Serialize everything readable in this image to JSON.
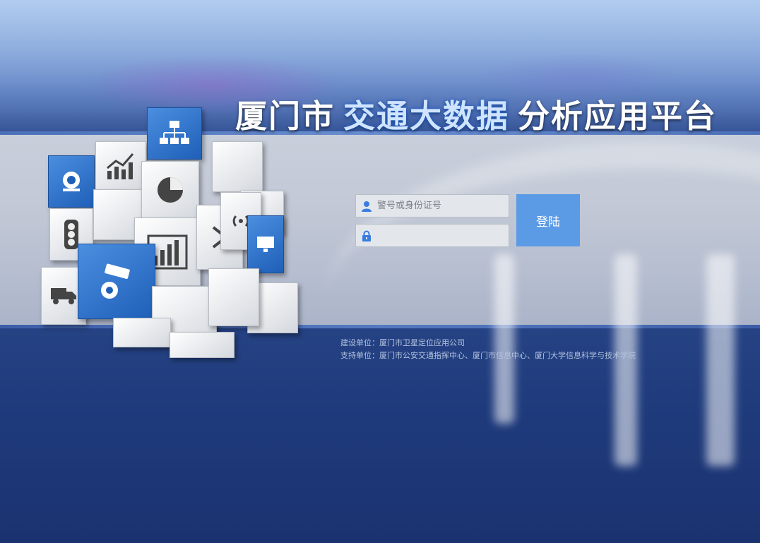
{
  "header": {
    "title_part1": "厦门市",
    "title_highlight": "交通大数据",
    "title_part2": "分析应用平台"
  },
  "login": {
    "username_placeholder": "警号或身份证号",
    "password_placeholder": "",
    "submit_label": "登陆"
  },
  "footer": {
    "builder": "建设单位：厦门市卫星定位应用公司",
    "supporter": "支持单位：厦门市公安交通指挥中心、厦门市信息中心、厦门大学信息科学与技术学院"
  },
  "colors": {
    "accent": "#5b9be6",
    "icon_blue": "#3b7ddd",
    "title_highlight": "#cfe4ff"
  },
  "icons": [
    "camera-icon",
    "trend-chart-icon",
    "network-icon",
    "traffic-light-icon",
    "pie-chart-icon",
    "bar-chart-icon",
    "road-sign-icon",
    "wifi-icon",
    "monitor-icon",
    "truck-icon",
    "cctv-icon",
    "user-icon",
    "lock-icon"
  ]
}
